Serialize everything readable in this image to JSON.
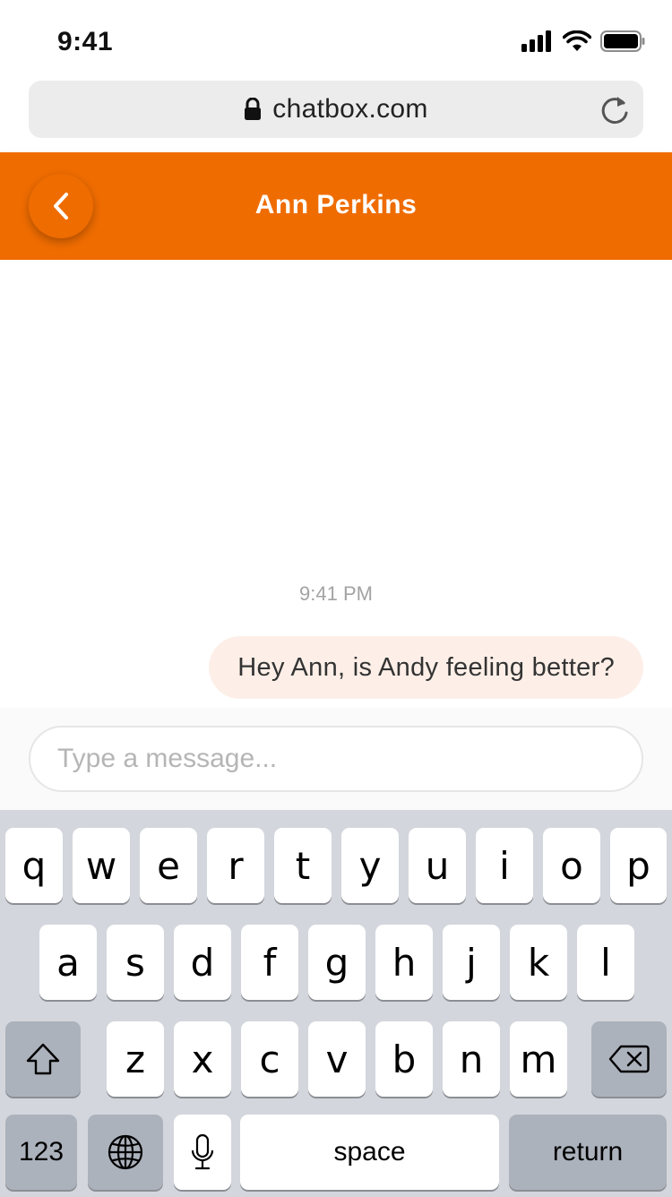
{
  "status": {
    "time": "9:41"
  },
  "browser": {
    "url": "chatbox.com"
  },
  "header": {
    "title": "Ann Perkins"
  },
  "chat": {
    "timestamp": "9:41 PM",
    "messages": [
      {
        "text": "Hey Ann, is Andy feeling better?"
      }
    ]
  },
  "composer": {
    "placeholder": "Type a message..."
  },
  "colors": {
    "accent": "#ef6c00",
    "bubble": "#fdefe8"
  },
  "keyboard": {
    "row1": [
      "q",
      "w",
      "e",
      "r",
      "t",
      "y",
      "u",
      "i",
      "o",
      "p"
    ],
    "row2": [
      "a",
      "s",
      "d",
      "f",
      "g",
      "h",
      "j",
      "k",
      "l"
    ],
    "row3": [
      "z",
      "x",
      "c",
      "v",
      "b",
      "n",
      "m"
    ],
    "numbers_label": "123",
    "space_label": "space",
    "return_label": "return"
  }
}
